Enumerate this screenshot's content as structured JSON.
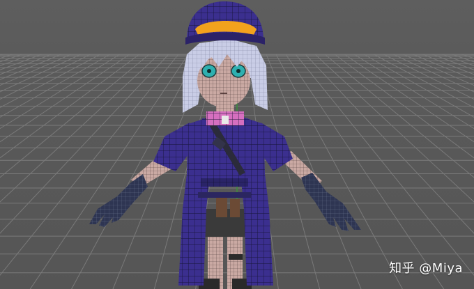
{
  "viewport": {
    "watermark": "知乎 @Miya",
    "background_color": "#5a5a5a",
    "grid_color": "#7a7a7a",
    "grid_axis_color": "#3c8f3c"
  },
  "model": {
    "outfit_color": "#3b2f8f",
    "hat_band_color": "#f2a21d",
    "collar_color": "#d66fbf",
    "hair_color": "#c9cde6",
    "skin_color": "#caa9a3",
    "eye_color": "#2fb0b0",
    "gloves_color": "#2e3552",
    "pouch_color": "#6b4a35"
  }
}
